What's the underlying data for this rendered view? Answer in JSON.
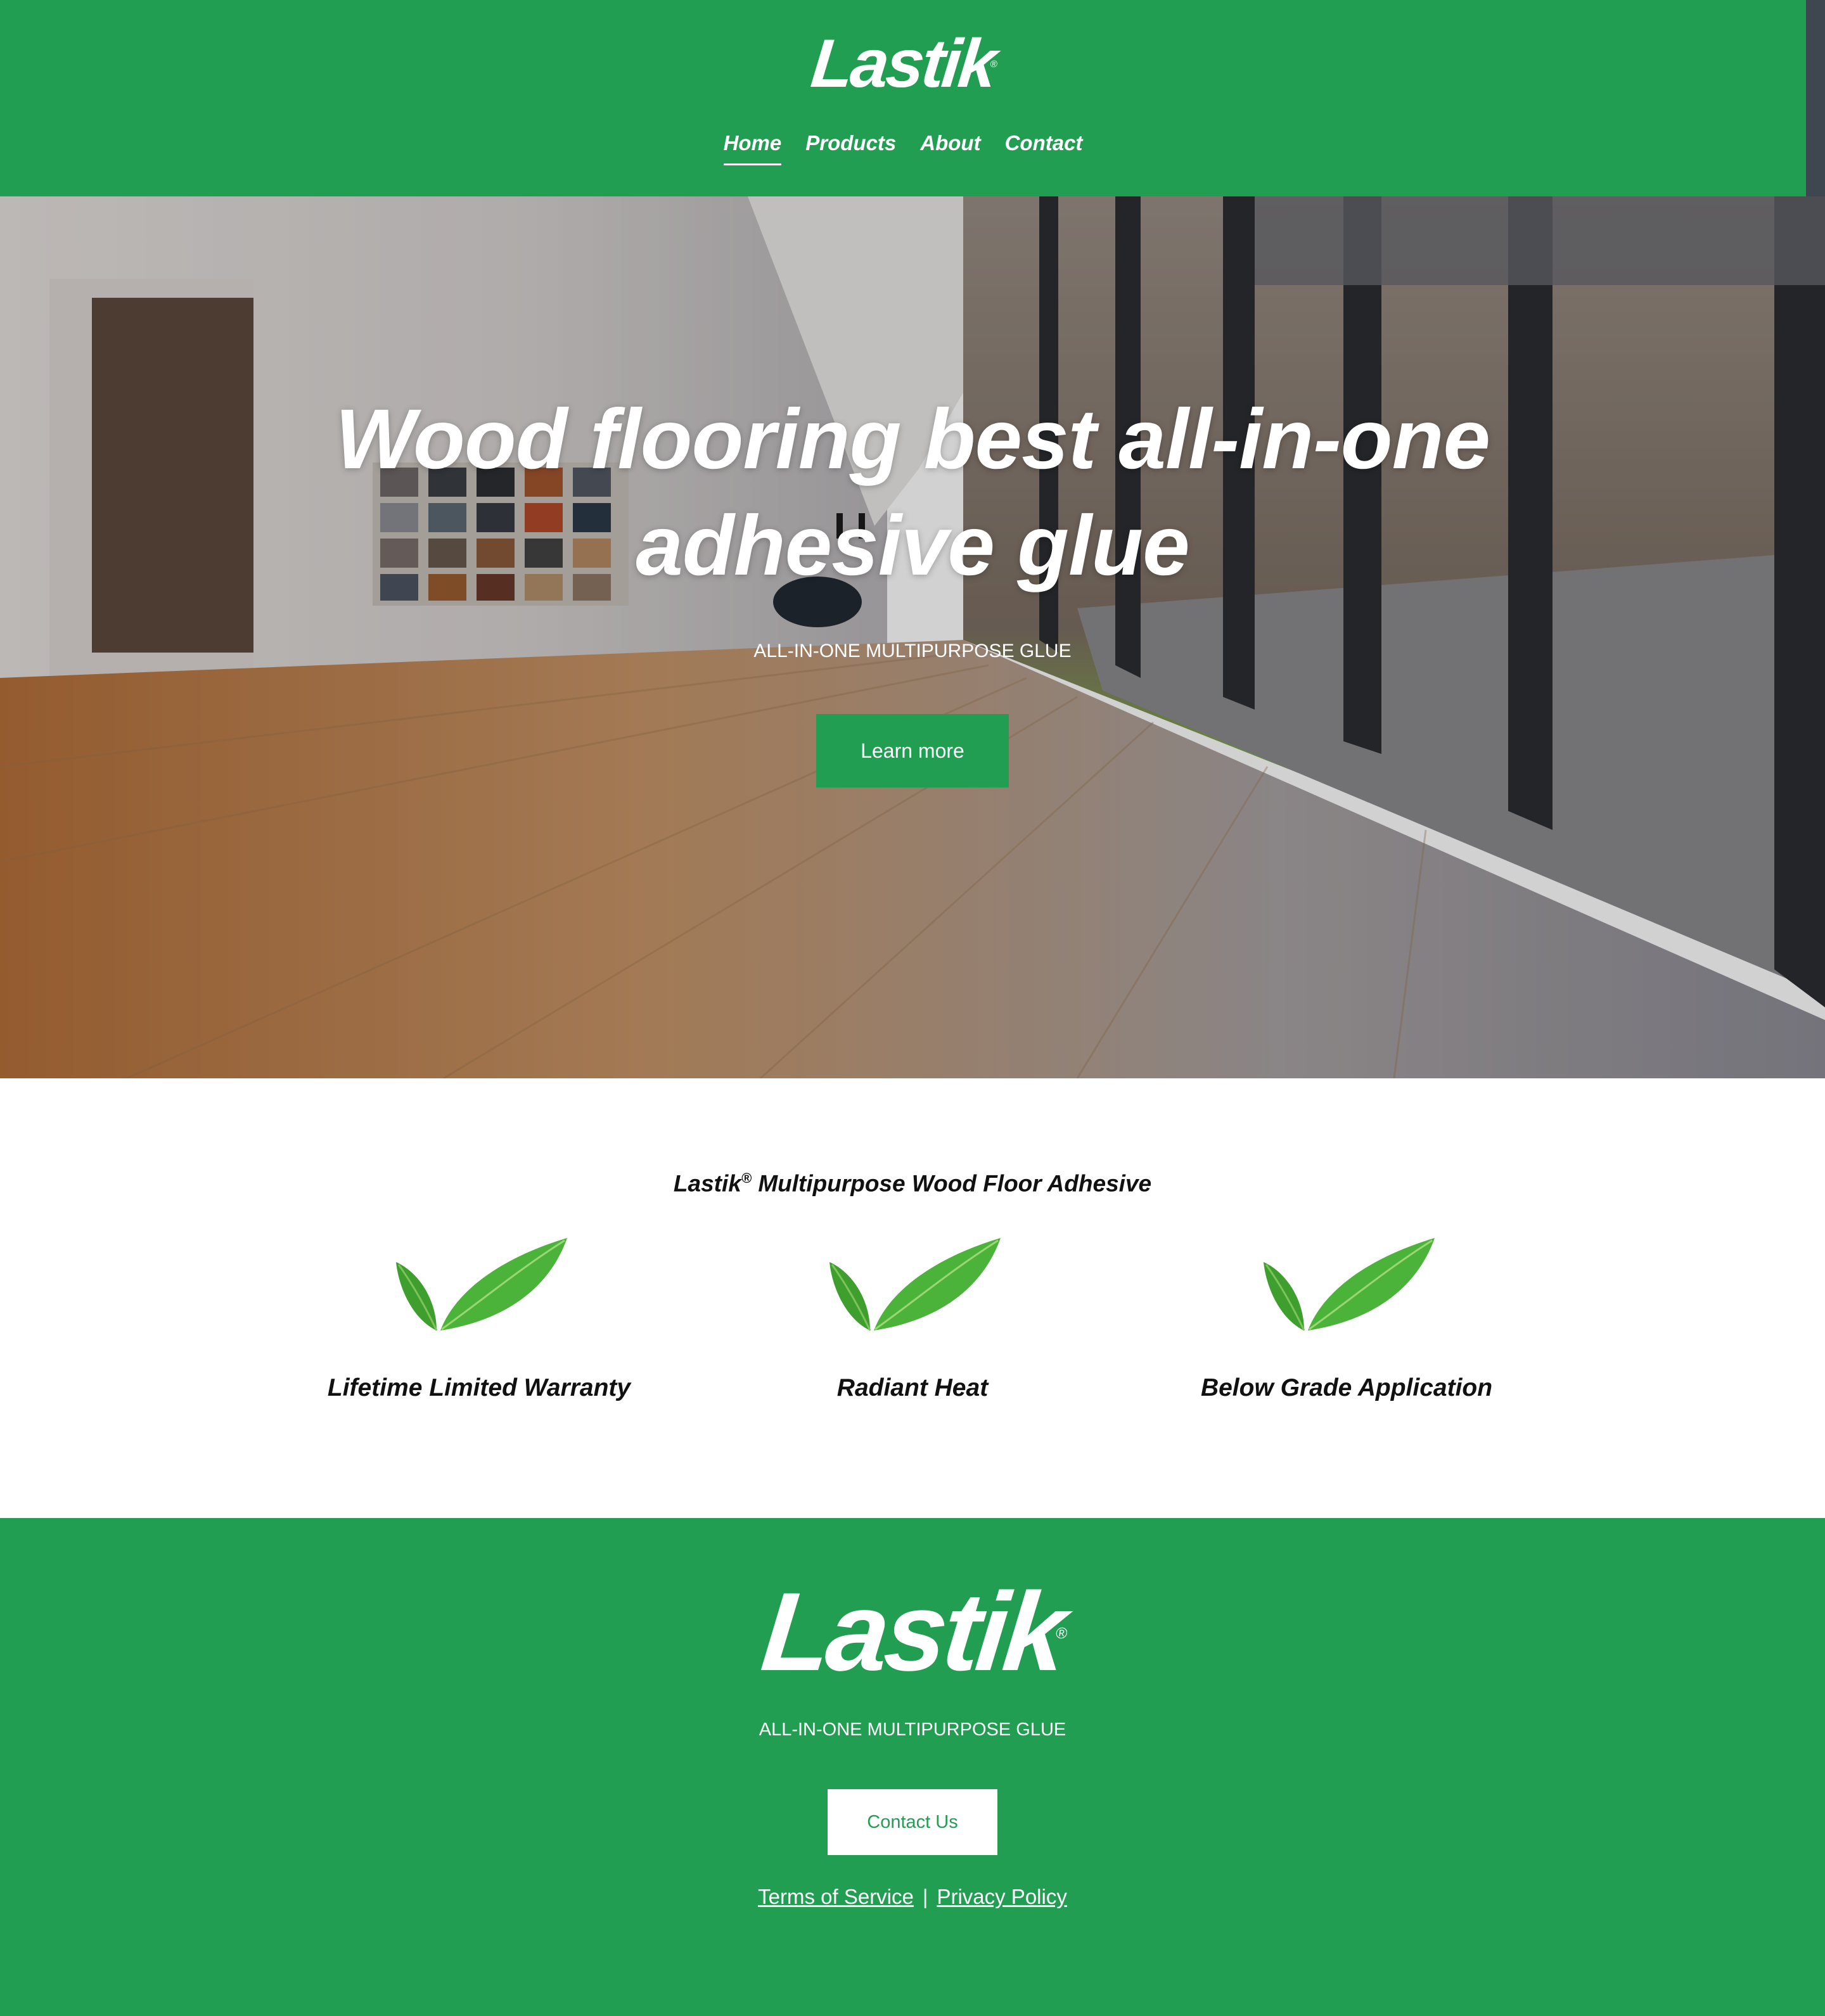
{
  "brand": {
    "logo_text": "Lastik",
    "registered_mark": "®",
    "primary_color": "#229e52"
  },
  "nav": {
    "items": [
      {
        "label": "Home",
        "active": true
      },
      {
        "label": "Products",
        "active": false
      },
      {
        "label": "About",
        "active": false
      },
      {
        "label": "Contact",
        "active": false
      }
    ]
  },
  "hero": {
    "title_line1": "Wood flooring best all-in-one",
    "title_line2": "adhesive glue",
    "subtitle": "ALL-IN-ONE MULTIPURPOSE GLUE",
    "button_label": "Learn more"
  },
  "features": {
    "title_brand": "Lastik",
    "title_mark": "®",
    "title_rest": " Multipurpose Wood Floor Adhesive",
    "items": [
      {
        "icon": "leaf-check-icon",
        "label": "Lifetime Limited Warranty"
      },
      {
        "icon": "leaf-check-icon",
        "label": "Radiant Heat"
      },
      {
        "icon": "leaf-check-icon",
        "label": "Below Grade Application"
      }
    ]
  },
  "footer": {
    "subtitle": "ALL-IN-ONE MULTIPURPOSE GLUE",
    "button_label": "Contact Us",
    "links": {
      "terms": "Terms of Service",
      "separator": "|",
      "privacy": "Privacy Policy"
    }
  }
}
